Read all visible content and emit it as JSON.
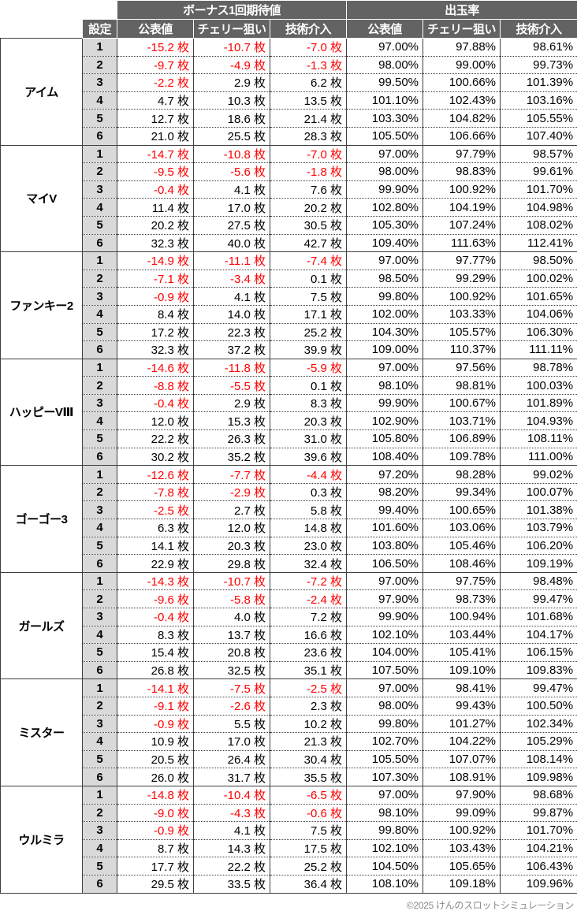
{
  "header": {
    "group_blank": "",
    "setting_label": "設定",
    "groups": [
      {
        "label": "ボーナス1回期待値",
        "span": 3
      },
      {
        "label": "出玉率",
        "span": 3
      }
    ],
    "columns": [
      "公表値",
      "チェリー狙い",
      "技術介入",
      "公表値",
      "チェリー狙い",
      "技術介入"
    ]
  },
  "footer": {
    "copyright": "©2025 けんのスロットシミュレーション"
  },
  "colors": {
    "header_bg": "#636363",
    "header_fg": "#ffffff",
    "setting_bg": "#d9d9d9",
    "negative": "#ff0000",
    "grid": "#3f3f3f",
    "footer_fg": "#8a8a8a"
  },
  "sections": [
    {
      "machine": "アイム",
      "rows": [
        {
          "setting": "1",
          "values": [
            "-15.2 枚",
            "-10.7 枚",
            "-7.0 枚",
            "97.00%",
            "97.88%",
            "98.61%"
          ]
        },
        {
          "setting": "2",
          "values": [
            "-9.7 枚",
            "-4.9 枚",
            "-1.3 枚",
            "98.00%",
            "99.00%",
            "99.73%"
          ]
        },
        {
          "setting": "3",
          "values": [
            "-2.2 枚",
            "2.9 枚",
            "6.2 枚",
            "99.50%",
            "100.66%",
            "101.39%"
          ]
        },
        {
          "setting": "4",
          "values": [
            "4.7 枚",
            "10.3 枚",
            "13.5 枚",
            "101.10%",
            "102.43%",
            "103.16%"
          ]
        },
        {
          "setting": "5",
          "values": [
            "12.7 枚",
            "18.6 枚",
            "21.4 枚",
            "103.30%",
            "104.82%",
            "105.55%"
          ]
        },
        {
          "setting": "6",
          "values": [
            "21.0 枚",
            "25.5 枚",
            "28.3 枚",
            "105.50%",
            "106.66%",
            "107.40%"
          ]
        }
      ]
    },
    {
      "machine": "マイV",
      "rows": [
        {
          "setting": "1",
          "values": [
            "-14.7 枚",
            "-10.8 枚",
            "-7.0 枚",
            "97.00%",
            "97.79%",
            "98.57%"
          ]
        },
        {
          "setting": "2",
          "values": [
            "-9.5 枚",
            "-5.6 枚",
            "-1.8 枚",
            "98.00%",
            "98.83%",
            "99.61%"
          ]
        },
        {
          "setting": "3",
          "values": [
            "-0.4 枚",
            "4.1 枚",
            "7.6 枚",
            "99.90%",
            "100.92%",
            "101.70%"
          ]
        },
        {
          "setting": "4",
          "values": [
            "11.4 枚",
            "17.0 枚",
            "20.2 枚",
            "102.80%",
            "104.19%",
            "104.98%"
          ]
        },
        {
          "setting": "5",
          "values": [
            "20.2 枚",
            "27.5 枚",
            "30.5 枚",
            "105.30%",
            "107.24%",
            "108.02%"
          ]
        },
        {
          "setting": "6",
          "values": [
            "32.3 枚",
            "40.0 枚",
            "42.7 枚",
            "109.40%",
            "111.63%",
            "112.41%"
          ]
        }
      ]
    },
    {
      "machine": "ファンキー2",
      "rows": [
        {
          "setting": "1",
          "values": [
            "-14.9 枚",
            "-11.1 枚",
            "-7.4 枚",
            "97.00%",
            "97.77%",
            "98.50%"
          ]
        },
        {
          "setting": "2",
          "values": [
            "-7.1 枚",
            "-3.4 枚",
            "0.1 枚",
            "98.50%",
            "99.29%",
            "100.02%"
          ]
        },
        {
          "setting": "3",
          "values": [
            "-0.9 枚",
            "4.1 枚",
            "7.5 枚",
            "99.80%",
            "100.92%",
            "101.65%"
          ]
        },
        {
          "setting": "4",
          "values": [
            "8.4 枚",
            "14.0 枚",
            "17.1 枚",
            "102.00%",
            "103.33%",
            "104.06%"
          ]
        },
        {
          "setting": "5",
          "values": [
            "17.2 枚",
            "22.3 枚",
            "25.2 枚",
            "104.30%",
            "105.57%",
            "106.30%"
          ]
        },
        {
          "setting": "6",
          "values": [
            "32.3 枚",
            "37.2 枚",
            "39.9 枚",
            "109.00%",
            "110.37%",
            "111.11%"
          ]
        }
      ]
    },
    {
      "machine": "ハッピーVⅢ",
      "rows": [
        {
          "setting": "1",
          "values": [
            "-14.6 枚",
            "-11.8 枚",
            "-5.9 枚",
            "97.00%",
            "97.56%",
            "98.78%"
          ]
        },
        {
          "setting": "2",
          "values": [
            "-8.8 枚",
            "-5.5 枚",
            "0.1 枚",
            "98.10%",
            "98.81%",
            "100.03%"
          ]
        },
        {
          "setting": "3",
          "values": [
            "-0.4 枚",
            "2.9 枚",
            "8.3 枚",
            "99.90%",
            "100.67%",
            "101.89%"
          ]
        },
        {
          "setting": "4",
          "values": [
            "12.0 枚",
            "15.3 枚",
            "20.3 枚",
            "102.90%",
            "103.71%",
            "104.93%"
          ]
        },
        {
          "setting": "5",
          "values": [
            "22.2 枚",
            "26.3 枚",
            "31.0 枚",
            "105.80%",
            "106.89%",
            "108.11%"
          ]
        },
        {
          "setting": "6",
          "values": [
            "30.2 枚",
            "35.2 枚",
            "39.6 枚",
            "108.40%",
            "109.78%",
            "111.00%"
          ]
        }
      ]
    },
    {
      "machine": "ゴーゴー3",
      "rows": [
        {
          "setting": "1",
          "values": [
            "-12.6 枚",
            "-7.7 枚",
            "-4.4 枚",
            "97.20%",
            "98.28%",
            "99.02%"
          ]
        },
        {
          "setting": "2",
          "values": [
            "-7.8 枚",
            "-2.9 枚",
            "0.3 枚",
            "98.20%",
            "99.34%",
            "100.07%"
          ]
        },
        {
          "setting": "3",
          "values": [
            "-2.5 枚",
            "2.7 枚",
            "5.8 枚",
            "99.40%",
            "100.65%",
            "101.38%"
          ]
        },
        {
          "setting": "4",
          "values": [
            "6.3 枚",
            "12.0 枚",
            "14.8 枚",
            "101.60%",
            "103.06%",
            "103.79%"
          ]
        },
        {
          "setting": "5",
          "values": [
            "14.1 枚",
            "20.3 枚",
            "23.0 枚",
            "103.80%",
            "105.46%",
            "106.20%"
          ]
        },
        {
          "setting": "6",
          "values": [
            "22.9 枚",
            "29.8 枚",
            "32.4 枚",
            "106.50%",
            "108.46%",
            "109.19%"
          ]
        }
      ]
    },
    {
      "machine": "ガールズ",
      "rows": [
        {
          "setting": "1",
          "values": [
            "-14.3 枚",
            "-10.7 枚",
            "-7.2 枚",
            "97.00%",
            "97.75%",
            "98.48%"
          ]
        },
        {
          "setting": "2",
          "values": [
            "-9.6 枚",
            "-5.8 枚",
            "-2.4 枚",
            "97.90%",
            "98.73%",
            "99.47%"
          ]
        },
        {
          "setting": "3",
          "values": [
            "-0.4 枚",
            "4.0 枚",
            "7.2 枚",
            "99.90%",
            "100.94%",
            "101.68%"
          ]
        },
        {
          "setting": "4",
          "values": [
            "8.3 枚",
            "13.7 枚",
            "16.6 枚",
            "102.10%",
            "103.44%",
            "104.17%"
          ]
        },
        {
          "setting": "5",
          "values": [
            "15.4 枚",
            "20.8 枚",
            "23.6 枚",
            "104.00%",
            "105.41%",
            "106.15%"
          ]
        },
        {
          "setting": "6",
          "values": [
            "26.8 枚",
            "32.5 枚",
            "35.1 枚",
            "107.50%",
            "109.10%",
            "109.83%"
          ]
        }
      ]
    },
    {
      "machine": "ミスター",
      "rows": [
        {
          "setting": "1",
          "values": [
            "-14.1 枚",
            "-7.5 枚",
            "-2.5 枚",
            "97.00%",
            "98.41%",
            "99.47%"
          ]
        },
        {
          "setting": "2",
          "values": [
            "-9.1 枚",
            "-2.6 枚",
            "2.3 枚",
            "98.00%",
            "99.43%",
            "100.50%"
          ]
        },
        {
          "setting": "3",
          "values": [
            "-0.9 枚",
            "5.5 枚",
            "10.2 枚",
            "99.80%",
            "101.27%",
            "102.34%"
          ]
        },
        {
          "setting": "4",
          "values": [
            "10.9 枚",
            "17.0 枚",
            "21.3 枚",
            "102.70%",
            "104.22%",
            "105.29%"
          ]
        },
        {
          "setting": "5",
          "values": [
            "20.5 枚",
            "26.4 枚",
            "30.4 枚",
            "105.50%",
            "107.07%",
            "108.14%"
          ]
        },
        {
          "setting": "6",
          "values": [
            "26.0 枚",
            "31.7 枚",
            "35.5 枚",
            "107.30%",
            "108.91%",
            "109.98%"
          ]
        }
      ]
    },
    {
      "machine": "ウルミラ",
      "rows": [
        {
          "setting": "1",
          "values": [
            "-14.8 枚",
            "-10.4 枚",
            "-6.5 枚",
            "97.00%",
            "97.90%",
            "98.68%"
          ]
        },
        {
          "setting": "2",
          "values": [
            "-9.0 枚",
            "-4.3 枚",
            "-0.6 枚",
            "98.10%",
            "99.09%",
            "99.87%"
          ]
        },
        {
          "setting": "3",
          "values": [
            "-0.9 枚",
            "4.1 枚",
            "7.5 枚",
            "99.80%",
            "100.92%",
            "101.70%"
          ]
        },
        {
          "setting": "4",
          "values": [
            "8.7 枚",
            "14.3 枚",
            "17.5 枚",
            "102.10%",
            "103.43%",
            "104.21%"
          ]
        },
        {
          "setting": "5",
          "values": [
            "17.7 枚",
            "22.2 枚",
            "25.2 枚",
            "104.50%",
            "105.65%",
            "106.43%"
          ]
        },
        {
          "setting": "6",
          "values": [
            "29.5 枚",
            "33.5 枚",
            "36.4 枚",
            "108.10%",
            "109.18%",
            "109.96%"
          ]
        }
      ]
    }
  ]
}
